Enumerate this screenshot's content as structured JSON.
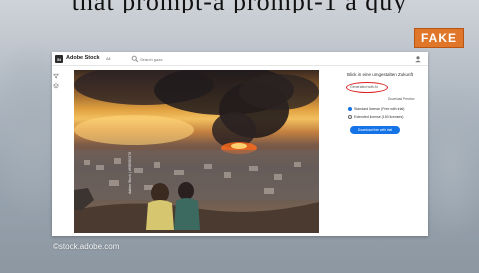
{
  "overlay": {
    "top_caption": "that prompt-a prompt-1 a quy",
    "fake_badge": "FAKE",
    "watermark": "©stock.adobe.com"
  },
  "topbar": {
    "brand": "Adobe Stock",
    "nav_all": "All",
    "search_placeholder": "Search gaza",
    "logo_letters": "St"
  },
  "photo": {
    "credit": "Adobe Stock | #658920276"
  },
  "panel": {
    "title": "Blick in eine umgestalten Zukunft",
    "gen_ai_label": "Generated with AI",
    "license_link": "Download Preview",
    "license_options": [
      {
        "label": "Standard license (Free with trial)",
        "selected": true
      },
      {
        "label": "Extended license (150 licenses)",
        "selected": false
      }
    ],
    "download_button": "Download free with trial"
  },
  "colors": {
    "accent": "#1473e6",
    "badge": "#e0762a",
    "highlight_circle": "#dd2222"
  },
  "icons": [
    "search-icon",
    "user-icon",
    "filter-icon",
    "layers-icon",
    "download-icon"
  ]
}
